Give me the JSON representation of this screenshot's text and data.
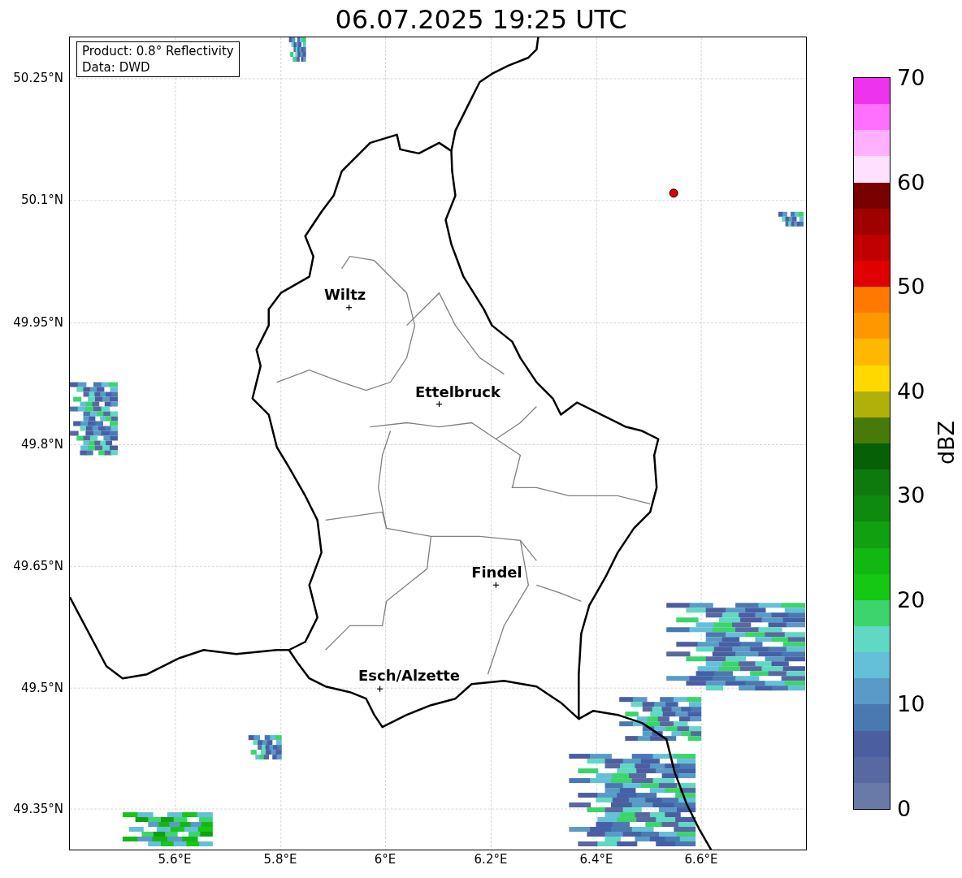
{
  "title": "06.07.2025 19:25 UTC",
  "info_box": [
    "Product: 0.8° Reflectivity",
    "Data: DWD"
  ],
  "lat_labels": [
    "50.25°N",
    "50.1°N",
    "49.95°N",
    "49.8°N",
    "49.65°N",
    "49.5°N",
    "49.35°N"
  ],
  "lon_labels": [
    "5.6°E",
    "5.8°E",
    "6°E",
    "6.2°E",
    "6.4°E",
    "6.6°E"
  ],
  "cities": [
    {
      "name": "Wiltz"
    },
    {
      "name": "Ettelbruck"
    },
    {
      "name": "Findel"
    },
    {
      "name": "Esch/Alzette"
    }
  ],
  "colorbar": {
    "label": "dBZ",
    "ticks": [
      "70",
      "60",
      "50",
      "40",
      "30",
      "20",
      "10",
      "0"
    ],
    "segments": [
      {
        "color": "#6a7aa8"
      },
      {
        "color": "#5868a0"
      },
      {
        "color": "#4a5ea0"
      },
      {
        "color": "#4a78b0"
      },
      {
        "color": "#5a9ac6"
      },
      {
        "color": "#64c0d8"
      },
      {
        "color": "#60d8c4"
      },
      {
        "color": "#3cd46c"
      },
      {
        "color": "#14c814"
      },
      {
        "color": "#12b812"
      },
      {
        "color": "#10a010"
      },
      {
        "color": "#0e8a0e"
      },
      {
        "color": "#0e7a0e"
      },
      {
        "color": "#066006"
      },
      {
        "color": "#487a0a"
      },
      {
        "color": "#b0b00a"
      },
      {
        "color": "#ffd800"
      },
      {
        "color": "#ffb800"
      },
      {
        "color": "#ff9800"
      },
      {
        "color": "#ff7800"
      },
      {
        "color": "#e00000"
      },
      {
        "color": "#c00000"
      },
      {
        "color": "#a00000"
      },
      {
        "color": "#780000"
      },
      {
        "color": "#ffe0ff"
      },
      {
        "color": "#ffb0ff"
      },
      {
        "color": "#ff70ff"
      },
      {
        "color": "#ee33ee"
      }
    ]
  }
}
